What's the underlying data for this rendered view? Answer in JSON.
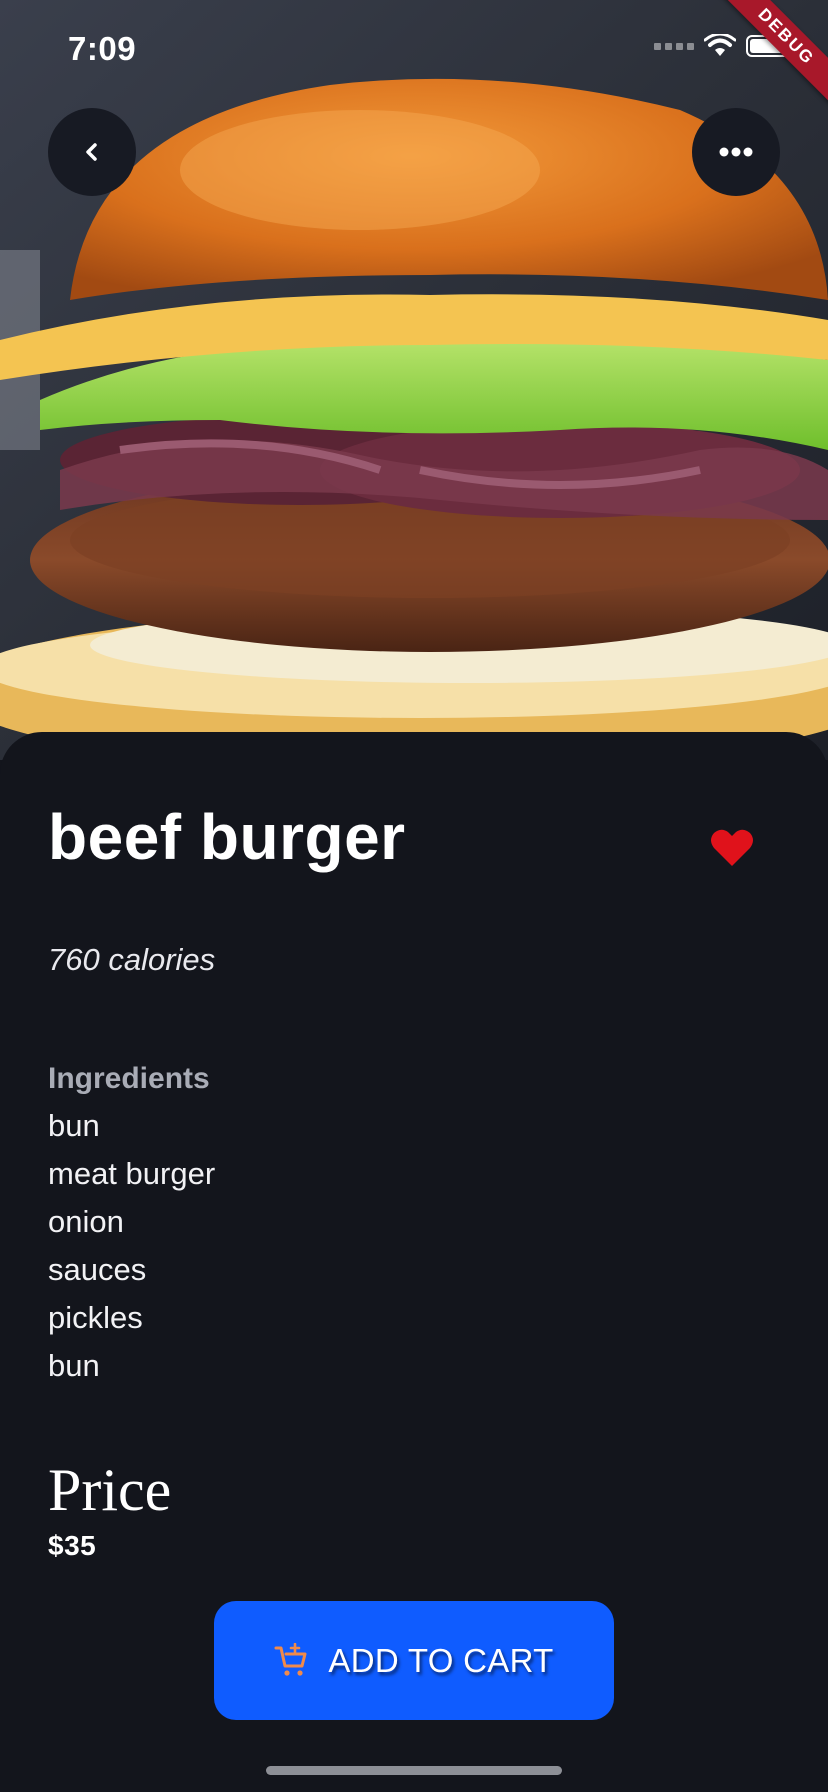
{
  "status_bar": {
    "time": "7:09",
    "debug_label": "DEBUG"
  },
  "header": {
    "back_icon": "chevron-left-icon",
    "more_icon": "more-horizontal-icon"
  },
  "product": {
    "name": "beef burger",
    "favorite": true,
    "favorite_color": "#e0121b",
    "calories": "760 calories",
    "ingredients_heading": "Ingredients",
    "ingredients": [
      "bun",
      "meat burger",
      "onion",
      "sauces",
      "pickles",
      "bun"
    ],
    "price_heading": "Price",
    "price": "$35"
  },
  "actions": {
    "add_to_cart_label": "ADD TO CART",
    "add_to_cart_icon": "cart-plus-icon",
    "accent_color": "#0f5cff",
    "icon_color": "#f08a4b"
  }
}
